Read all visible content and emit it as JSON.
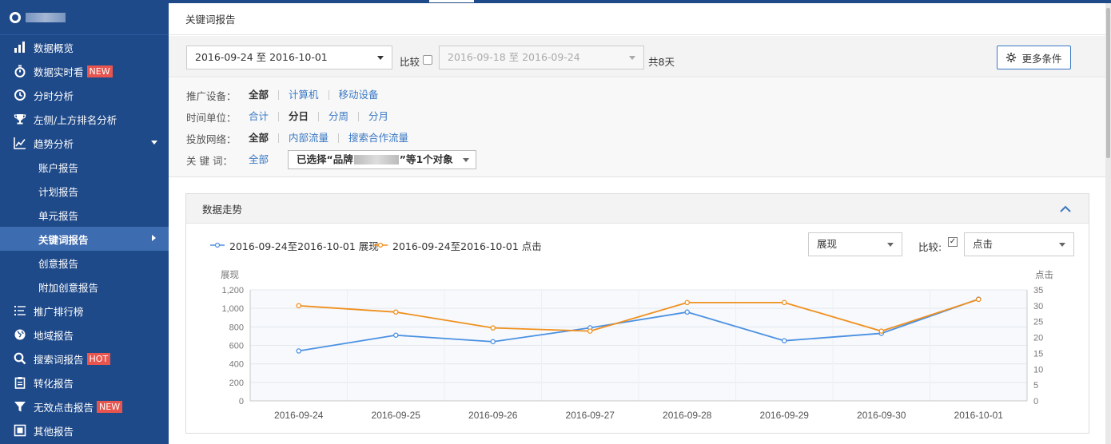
{
  "sidebar": {
    "items": [
      {
        "label": "数据概览",
        "icon": "bar-chart-icon",
        "badge": ""
      },
      {
        "label": "数据实时看",
        "icon": "stopwatch-icon",
        "badge": "NEW"
      },
      {
        "label": "分时分析",
        "icon": "clock-icon",
        "badge": ""
      },
      {
        "label": "左侧/上方排名分析",
        "icon": "trophy-icon",
        "badge": ""
      },
      {
        "label": "趋势分析",
        "icon": "trend-icon",
        "badge": ""
      }
    ],
    "sub_items": [
      "账户报告",
      "计划报告",
      "单元报告",
      "关键词报告",
      "创意报告",
      "附加创意报告"
    ],
    "active_sub": "关键词报告",
    "items_after": [
      {
        "label": "推广排行榜",
        "icon": "ranking-list-icon",
        "badge": ""
      },
      {
        "label": "地域报告",
        "icon": "globe-icon",
        "badge": ""
      },
      {
        "label": "搜索词报告",
        "icon": "search-icon",
        "badge": "HOT"
      },
      {
        "label": "转化报告",
        "icon": "clipboard-icon",
        "badge": ""
      },
      {
        "label": "无效点击报告",
        "icon": "filter-icon",
        "badge": "NEW"
      },
      {
        "label": "其他报告",
        "icon": "report-icon",
        "badge": ""
      }
    ]
  },
  "page": {
    "title": "关键词报告"
  },
  "filters": {
    "date_range": "2016-09-24 至 2016-10-01",
    "compare_label": "比较",
    "compare_range": "2016-09-18 至 2016-09-24",
    "total_days": "共8天",
    "more_button": "更多条件",
    "device": {
      "label": "推广设备：",
      "options": [
        "全部",
        "计算机",
        "移动设备"
      ],
      "selected": "全部"
    },
    "time_unit": {
      "label": "时间单位：",
      "options": [
        "合计",
        "分日",
        "分周",
        "分月"
      ],
      "selected": "分日"
    },
    "network": {
      "label": "投放网络：",
      "options": [
        "全部",
        "内部流量",
        "搜索合作流量"
      ],
      "selected": "全部"
    },
    "keyword": {
      "label": "关 键 词：",
      "all": "全部",
      "select_prefix": "已选择“品牌",
      "select_suffix": "”等1个对象"
    }
  },
  "panel": {
    "title": "数据走势",
    "metric_left": "展现",
    "compare_label": "比较:",
    "metric_right": "点击"
  },
  "chart_data": {
    "type": "line",
    "categories": [
      "2016-09-24",
      "2016-09-25",
      "2016-09-26",
      "2016-09-27",
      "2016-09-28",
      "2016-09-29",
      "2016-09-30",
      "2016-10-01"
    ],
    "series": [
      {
        "name": "2016-09-24至2016-10-01 展现",
        "axis": "left",
        "color": "#4a90e2",
        "values": [
          540,
          710,
          640,
          790,
          960,
          650,
          730,
          1100
        ]
      },
      {
        "name": "2016-09-24至2016-10-01 点击",
        "axis": "right",
        "color": "#f0901e",
        "values": [
          30,
          28,
          23,
          22,
          31,
          31,
          22,
          32
        ]
      }
    ],
    "ylabel_left": "展现",
    "ylabel_right": "点击",
    "yticks_left": [
      "0",
      "200",
      "400",
      "600",
      "800",
      "1,000",
      "1,200"
    ],
    "yticks_right": [
      "0",
      "5",
      "10",
      "15",
      "20",
      "25",
      "30",
      "35"
    ],
    "ylim_left": [
      0,
      1200
    ],
    "ylim_right": [
      0,
      35
    ],
    "grid": true,
    "legend": "top-left"
  }
}
